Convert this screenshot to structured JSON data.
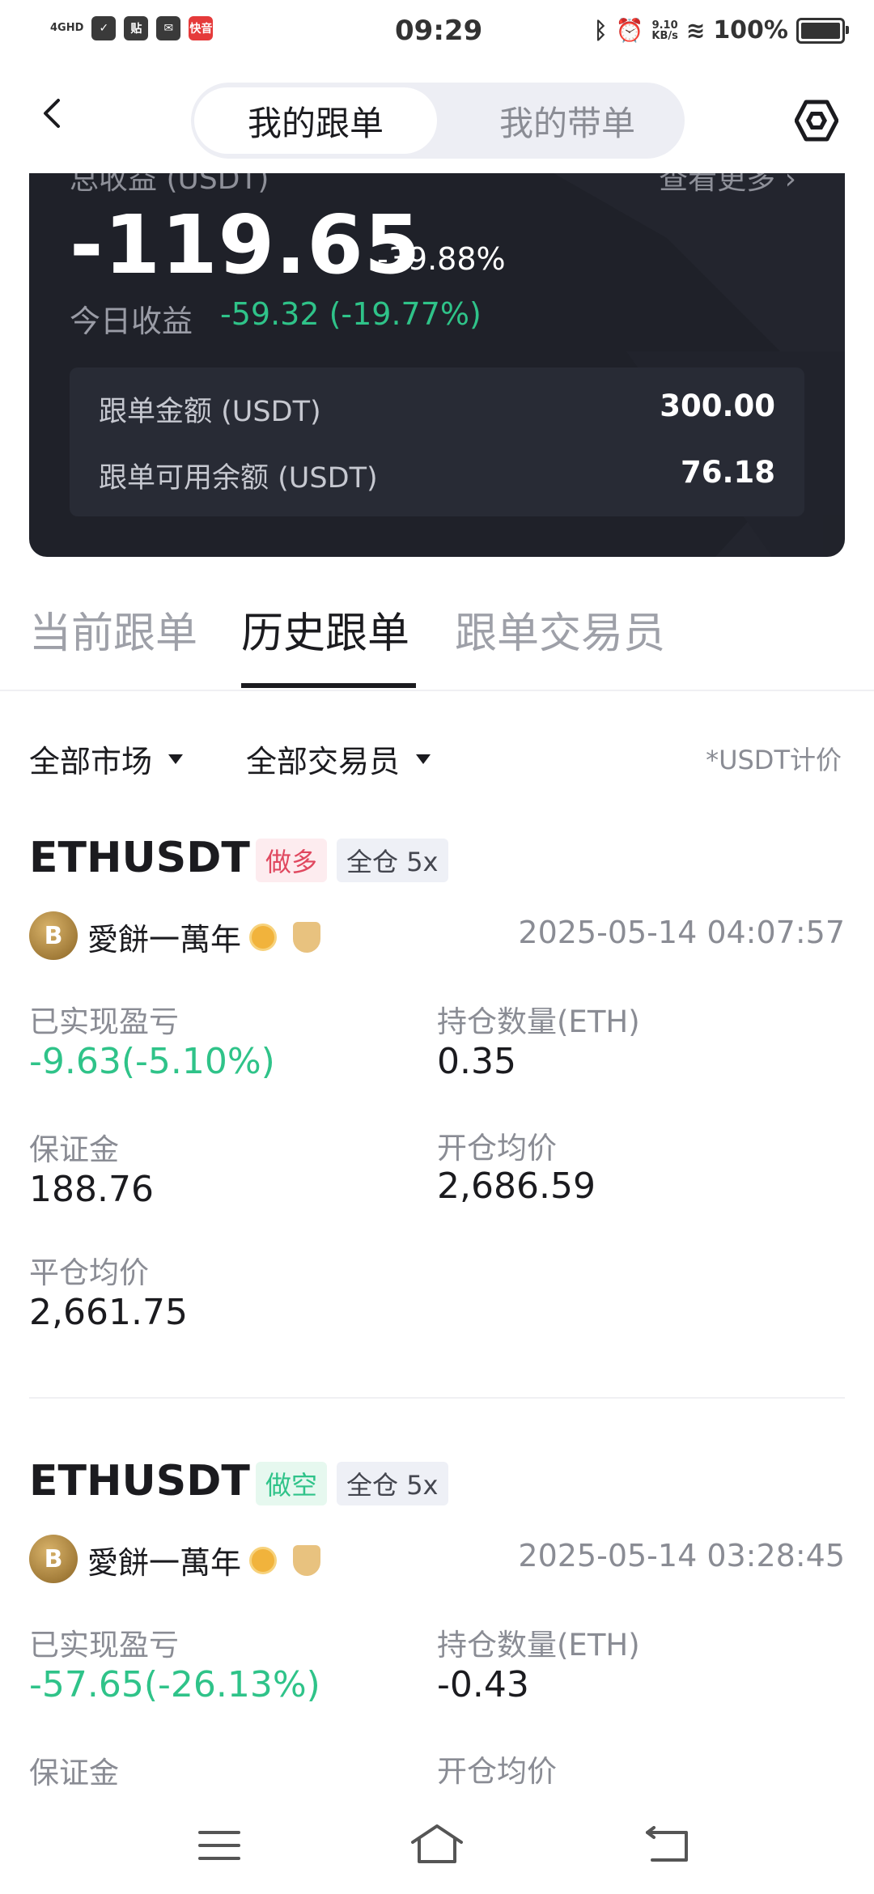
{
  "status_bar": {
    "time": "09:29",
    "network": "4GHD",
    "app_icon_tie": "贴",
    "app_icon_kuaiyin": "快音",
    "speed_value": "9.10",
    "speed_unit": "KB/s",
    "battery": "100%"
  },
  "header": {
    "tab_active": "我的跟单",
    "tab_inactive": "我的带单"
  },
  "summary": {
    "total_label": "总收益 (USDT)",
    "more_label": "查看更多",
    "total_value": "-119.65",
    "total_pct": "-39.88%",
    "today_label": "今日收益",
    "today_value": "-59.32 (-19.77%)",
    "copy_amount_label": "跟单金额 (USDT)",
    "copy_amount_value": "300.00",
    "available_label": "跟单可用余额 (USDT)",
    "available_value": "76.18"
  },
  "tabs": [
    "当前跟单",
    "历史跟单",
    "跟单交易员"
  ],
  "filters": {
    "market": "全部市场",
    "trader": "全部交易员",
    "note": "*USDT计价"
  },
  "orders": [
    {
      "symbol": "ETHUSDT",
      "side": "做多",
      "mode": "全仓 5x",
      "avatar": "B",
      "trader": "愛餅一萬年",
      "time": "2025-05-14 04:07:57",
      "pnl_label": "已实现盈亏",
      "pnl_value": "-9.63(-5.10%)",
      "qty_label": "持仓数量(ETH)",
      "qty_value": "0.35",
      "margin_label": "保证金",
      "margin_value": "188.76",
      "open_label": "开仓均价",
      "open_value": "2,686.59",
      "close_label": "平仓均价",
      "close_value": "2,661.75"
    },
    {
      "symbol": "ETHUSDT",
      "side": "做空",
      "mode": "全仓 5x",
      "avatar": "B",
      "trader": "愛餅一萬年",
      "time": "2025-05-14 03:28:45",
      "pnl_label": "已实现盈亏",
      "pnl_value": "-57.65(-26.13%)",
      "qty_label": "持仓数量(ETH)",
      "qty_value": "-0.43",
      "margin_label": "保证金",
      "open_label": "开仓均价"
    }
  ],
  "colors": {
    "profit_green": "#2fc389",
    "long_red": "#e0485f",
    "card_dark": "#1f2129"
  }
}
